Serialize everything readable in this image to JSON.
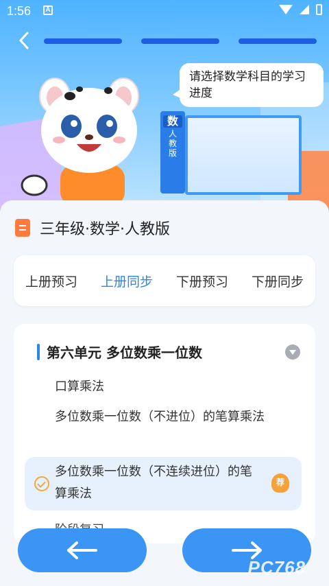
{
  "status": {
    "time": "1:56",
    "notification_letter": "A"
  },
  "header": {
    "speech_bubble": "请选择数学科目的学习进度",
    "book_spine_big": "数",
    "book_spine_small": "人\n教\n版"
  },
  "course": {
    "title": "三年级·数学·人教版"
  },
  "tabs": [
    {
      "label": "上册预习",
      "active": false
    },
    {
      "label": "上册同步",
      "active": true
    },
    {
      "label": "下册预习",
      "active": false
    },
    {
      "label": "下册同步",
      "active": false
    }
  ],
  "unit": {
    "title": "第六单元 多位数乘一位数",
    "lessons": [
      {
        "label": "口算乘法",
        "selected": false
      },
      {
        "label": "多位数乘一位数（不进位）的笔算乘法",
        "selected": false
      },
      {
        "label": "多位数乘一位数（不连续进位）的笔算乘法",
        "selected": true,
        "badge": "荐"
      },
      {
        "label": "阶段复习",
        "selected": false
      }
    ]
  },
  "watermark": "PC768",
  "colors": {
    "accent": "#2a86ea",
    "button": "#3a95f4",
    "badge": "#f4a23a"
  }
}
